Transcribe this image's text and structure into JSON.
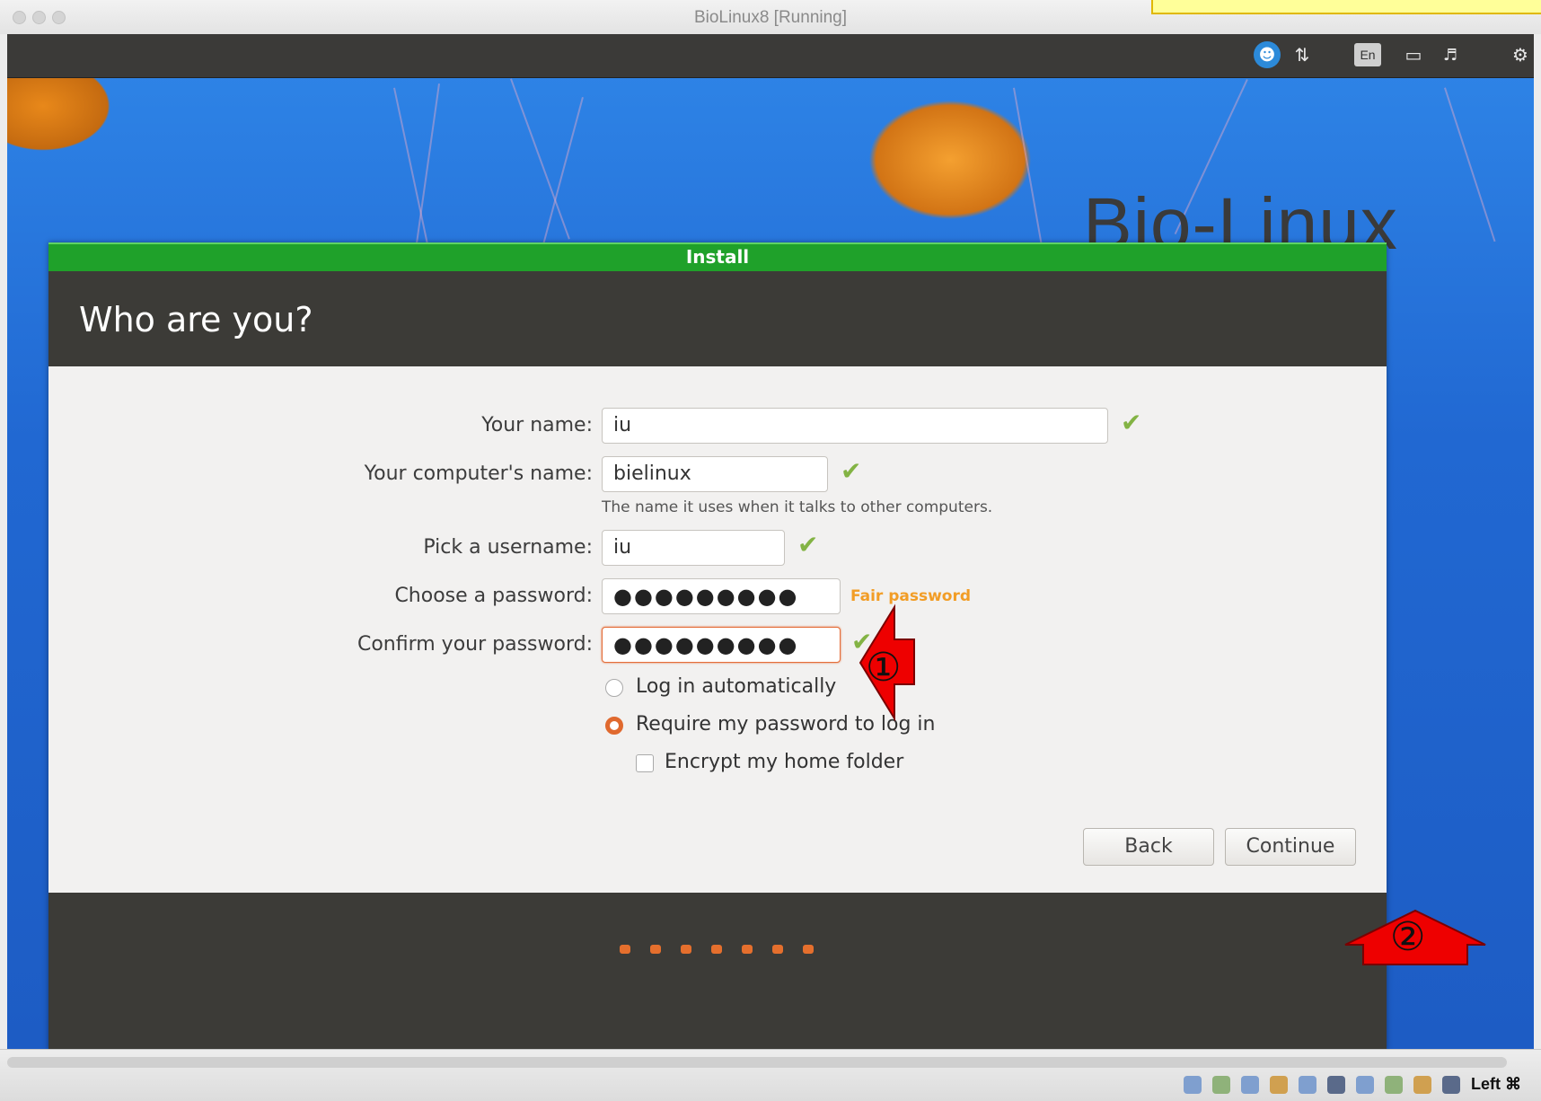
{
  "window": {
    "title": "BioLinux8 [Running]"
  },
  "panel": {
    "tray_icons": [
      "accessibility-icon",
      "network-icon",
      "keyboard-layout-icon",
      "battery-icon",
      "volume-icon",
      "settings-gear-icon"
    ],
    "keyboard_layout": "En"
  },
  "wallpaper": {
    "brand": "Bio-Linux"
  },
  "dialog": {
    "title": "Install",
    "heading": "Who are you?",
    "fields": {
      "name": {
        "label": "Your name:",
        "value": "iu"
      },
      "computer": {
        "label": "Your computer's name:",
        "value": "bielinux",
        "hint": "The name it uses when it talks to other computers."
      },
      "username": {
        "label": "Pick a username:",
        "value": "iu"
      },
      "password": {
        "label": "Choose a password:",
        "value": "●●●●●●●●●",
        "strength": "Fair password"
      },
      "confirm": {
        "label": "Confirm your password:",
        "value": "●●●●●●●●●"
      }
    },
    "options": {
      "auto_login": "Log in automatically",
      "require_password": "Require my password to log in",
      "encrypt_home": "Encrypt my home folder"
    },
    "selected_login_option": "require_password",
    "encrypt_checked": false,
    "buttons": {
      "back": "Back",
      "continue": "Continue"
    },
    "progress": {
      "total_steps": 7
    }
  },
  "annotations": {
    "marker1": "①",
    "marker2": "②"
  },
  "statusbar": {
    "host_key": "Left ⌘"
  },
  "colors": {
    "title_green": "#1fa12a",
    "header_dark": "#3c3b37",
    "accent_orange": "#e0692e",
    "strength_orange": "#f29d26",
    "check_green": "#83b344",
    "arrow_red": "#ee0000"
  }
}
